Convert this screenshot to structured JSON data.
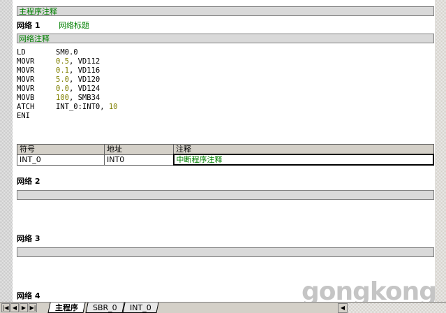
{
  "main_comment": "主程序注释",
  "networks": [
    {
      "title": "网络 1",
      "subtitle": "网络标题",
      "comment": "网络注释"
    },
    {
      "title": "网络 2"
    },
    {
      "title": "网络 3"
    },
    {
      "title": "网络 4"
    }
  ],
  "stl_lines": [
    {
      "op": "LD",
      "pre": "SM0.0",
      "num": "",
      "post": ""
    },
    {
      "op": "MOVR",
      "pre": "",
      "num": "0.5",
      "post": ", VD112"
    },
    {
      "op": "MOVR",
      "pre": "",
      "num": "0.1",
      "post": ", VD116"
    },
    {
      "op": "MOVR",
      "pre": "",
      "num": "5.0",
      "post": ", VD120"
    },
    {
      "op": "MOVR",
      "pre": "",
      "num": "0.0",
      "post": ", VD124"
    },
    {
      "op": "MOVB",
      "pre": "",
      "num": "100",
      "post": ", SMB34"
    },
    {
      "op": "ATCH",
      "pre": "INT_0:INT0, ",
      "num": "10",
      "post": ""
    },
    {
      "op": "ENI",
      "pre": "",
      "num": "",
      "post": ""
    }
  ],
  "symbol_table": {
    "headers": [
      "符号",
      "地址",
      "注释"
    ],
    "rows": [
      [
        "INT_0",
        "INT0",
        "中断程序注释"
      ]
    ]
  },
  "tabs": [
    "主程序",
    "SBR_0",
    "INT_0"
  ],
  "nav_buttons": [
    "|◀",
    "◀",
    "▶",
    "▶|"
  ],
  "watermark": "gongkong"
}
